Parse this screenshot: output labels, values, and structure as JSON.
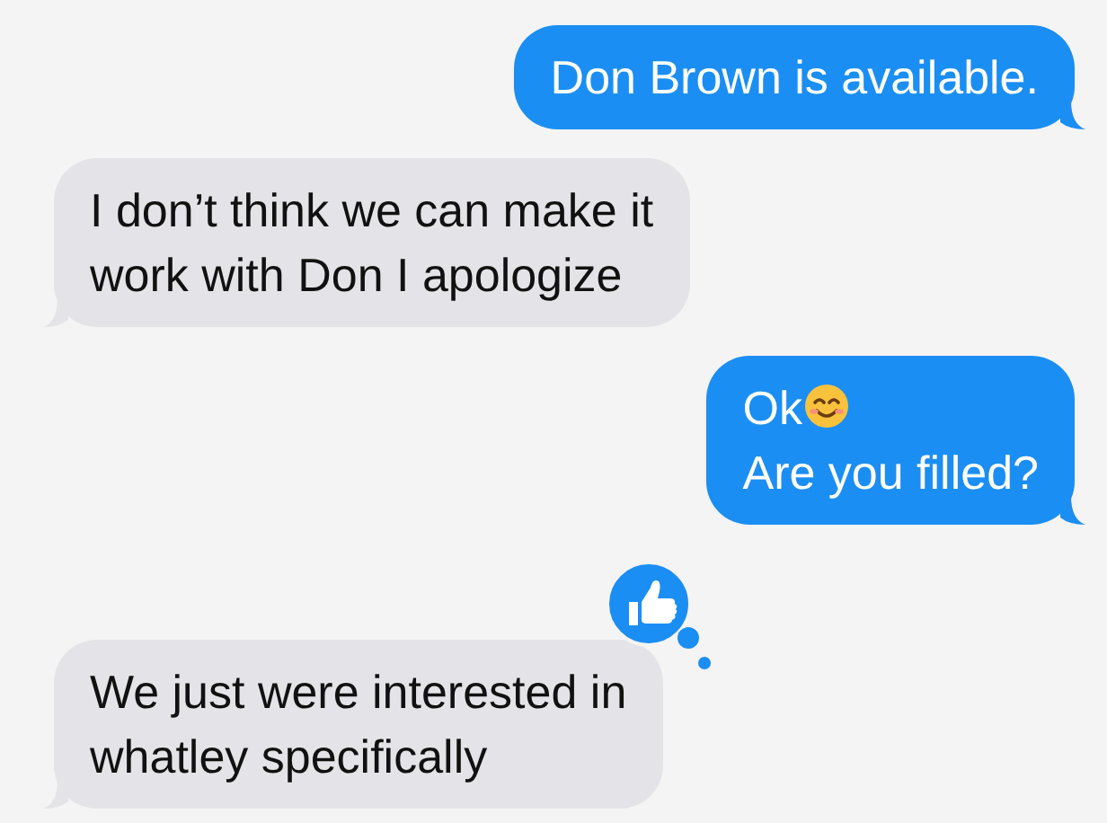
{
  "messages": [
    {
      "kind": "sent",
      "lines": [
        {
          "text": "Don Brown is available.",
          "emoji": false
        }
      ],
      "reaction": false
    },
    {
      "kind": "received",
      "lines": [
        {
          "text": "I don’t think we can make it",
          "emoji": false
        },
        {
          "text": "work with Don I apologize",
          "emoji": false
        }
      ],
      "reaction": false
    },
    {
      "kind": "sent",
      "lines": [
        {
          "text": "Ok",
          "emoji": true
        },
        {
          "text": "Are you filled?",
          "emoji": false
        }
      ],
      "reaction": false
    },
    {
      "kind": "received",
      "lines": [
        {
          "text": "We just were interested in",
          "emoji": false
        },
        {
          "text": "whatley specifically",
          "emoji": false
        }
      ],
      "reaction": true
    }
  ]
}
